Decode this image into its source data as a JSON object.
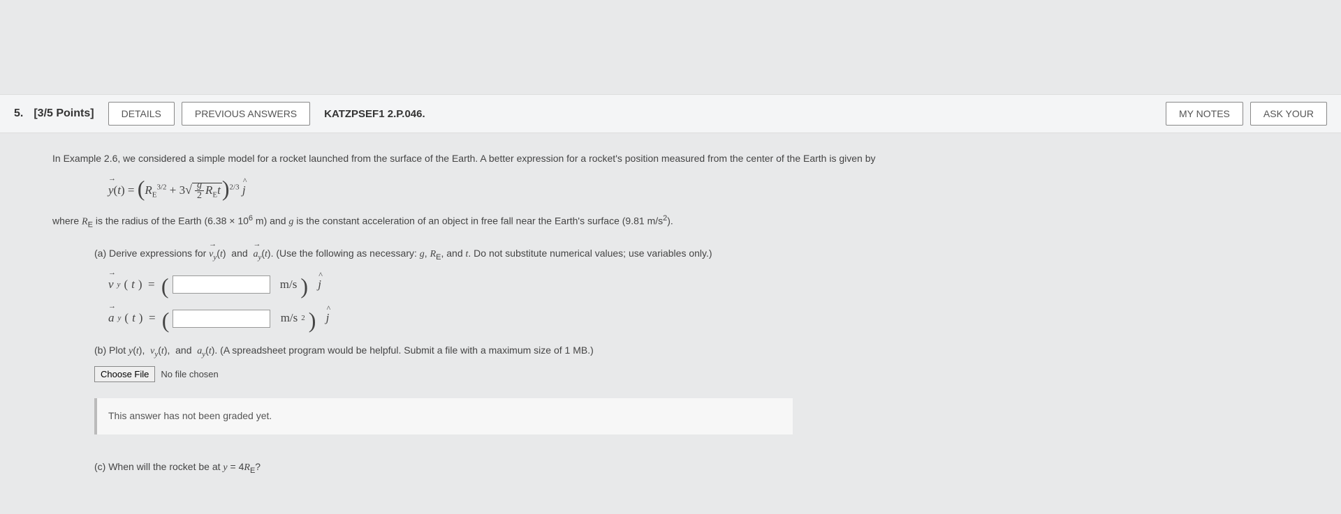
{
  "header": {
    "number": "5.",
    "points": "[3/5 Points]",
    "details_btn": "DETAILS",
    "prev_answers_btn": "PREVIOUS ANSWERS",
    "problem_ref": "KATZPSEF1 2.P.046.",
    "my_notes_btn": "MY NOTES",
    "ask_your_btn": "ASK YOUR"
  },
  "problem": {
    "intro": "In Example 2.6, we considered a simple model for a rocket launched from the surface of the Earth. A better expression for a rocket's position measured from the center of the Earth is given by",
    "where_prefix": "where ",
    "where_mid1": " is the radius of the Earth (6.38 × 10",
    "where_mid2": " m) and ",
    "where_mid3": " is the constant acceleration of an object in free fall near the Earth's surface (9.81 m/s",
    "where_suffix": ").",
    "part_a": {
      "label": "(a) Derive expressions for ",
      "instr": ". (Use the following as necessary: ",
      "instr_end": ". Do not substitute numerical values; use variables only.)",
      "vy_unit": "m/s",
      "ay_unit": "m/s"
    },
    "part_b": {
      "text": "(b) Plot ",
      "text_end": ". (A spreadsheet program would be helpful. Submit a file with a maximum size of 1 MB.)",
      "choose_file": "Choose File",
      "no_file": "No file chosen"
    },
    "grading": "This answer has not been graded yet.",
    "part_c": {
      "text": "(c) When will the rocket be at "
    }
  }
}
